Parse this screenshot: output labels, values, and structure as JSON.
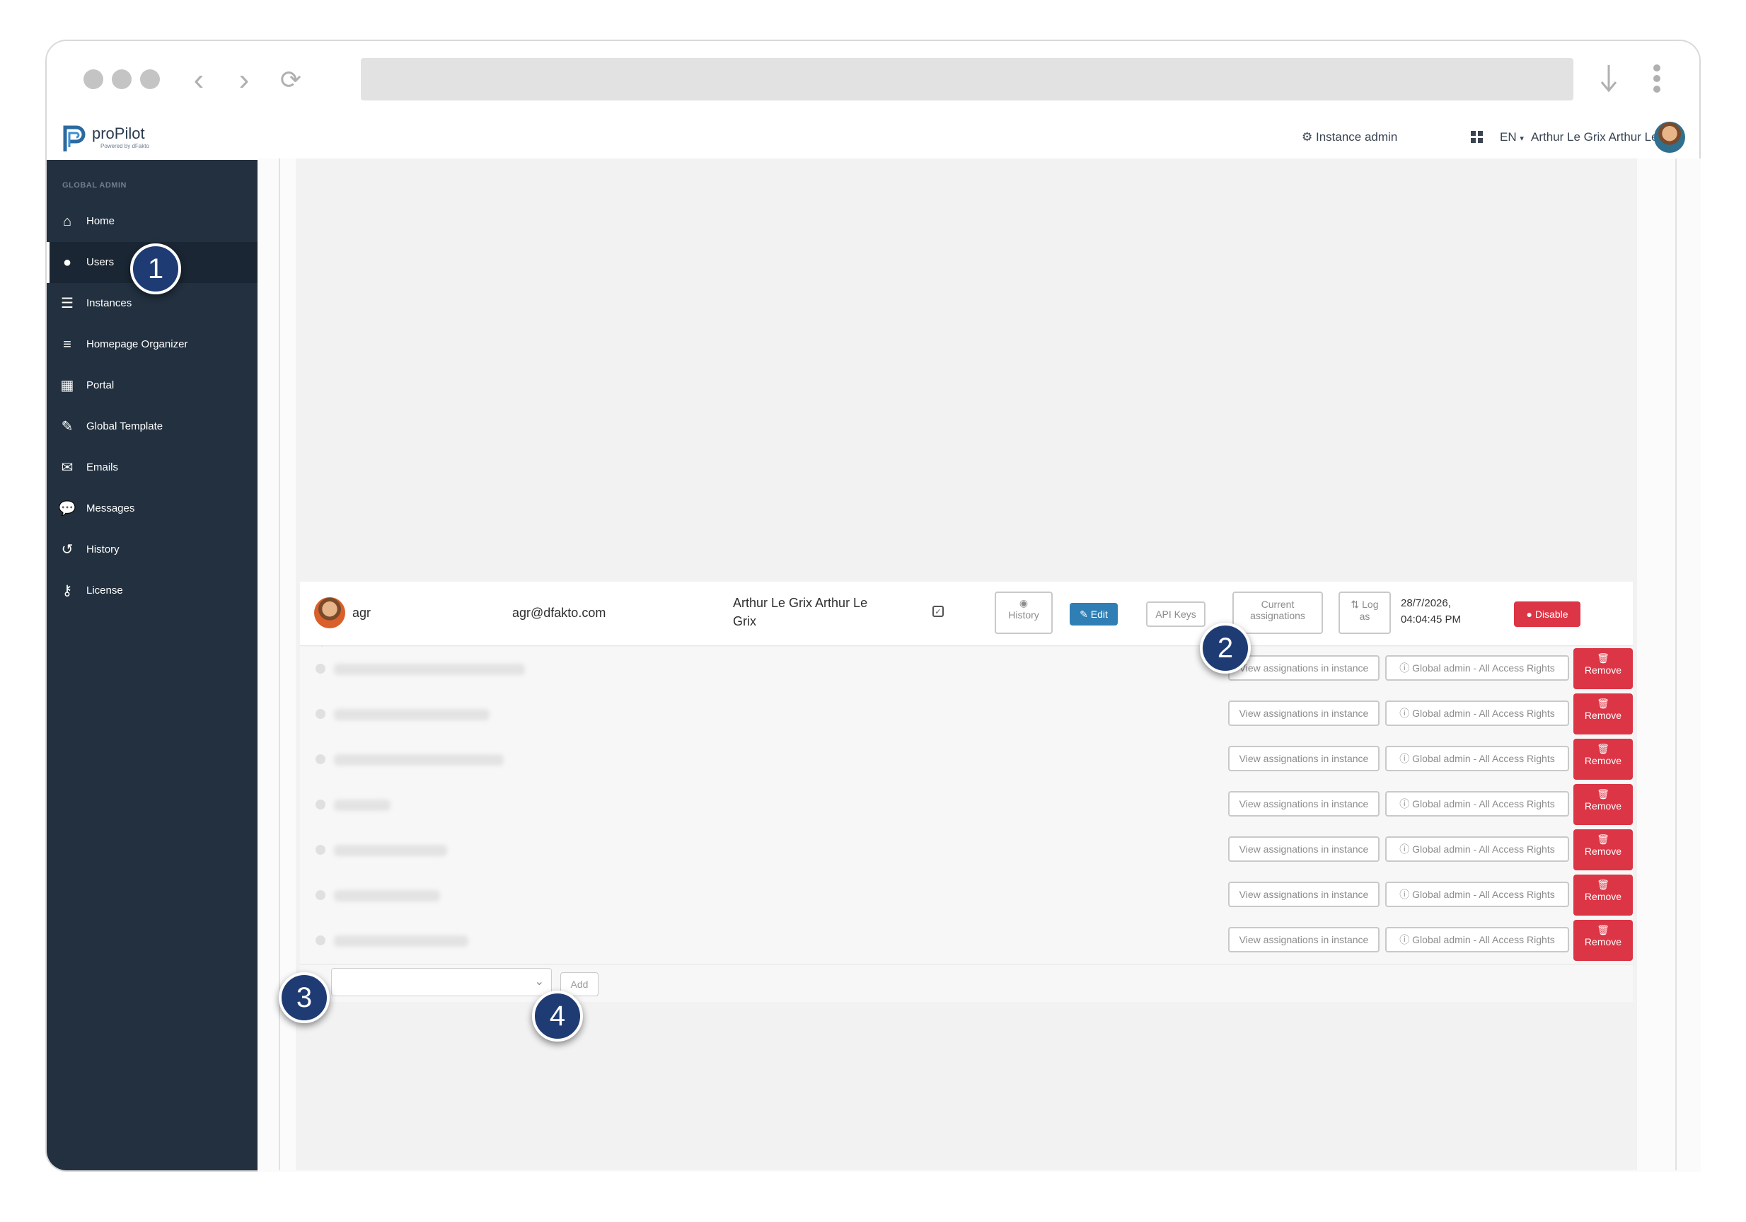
{
  "header": {
    "brand": "proPilot",
    "brand_sub": "Powered by dFakto",
    "instance_admin": "Instance admin",
    "language": "EN",
    "user_name": "Arthur Le Grix Arthur Le Grix"
  },
  "sidebar": {
    "section_title": "GLOBAL ADMIN",
    "items": [
      {
        "label": "Home",
        "icon": "home-icon"
      },
      {
        "label": "Users",
        "icon": "user-icon"
      },
      {
        "label": "Instances",
        "icon": "list-icon"
      },
      {
        "label": "Homepage Organizer",
        "icon": "menu-icon"
      },
      {
        "label": "Portal",
        "icon": "grid-icon"
      },
      {
        "label": "Global Template",
        "icon": "brush-icon"
      },
      {
        "label": "Emails",
        "icon": "envelope-icon"
      },
      {
        "label": "Messages",
        "icon": "chat-icon"
      },
      {
        "label": "History",
        "icon": "history-icon"
      },
      {
        "label": "License",
        "icon": "key-icon"
      }
    ]
  },
  "user_row": {
    "username": "agr",
    "email": "agr@dfakto.com",
    "full_name_line1": "Arthur Le Grix Arthur Le",
    "full_name_line2": "Grix",
    "history_label": "History",
    "edit_label": "Edit",
    "api_keys_label": "API Keys",
    "current_assign_line1": "Current",
    "current_assign_line2": "assignations",
    "log_as_line1": "Log",
    "log_as_line2": "as",
    "date_line1": "28/7/2026,",
    "date_line2": "04:04:45 PM",
    "disable_label": "Disable"
  },
  "assignments": {
    "view_label": "View assignations in instance",
    "global_label": "Global admin - All Access Rights",
    "remove_label": "Remove",
    "rows": 7
  },
  "add_row": {
    "add_label": "Add"
  },
  "callouts": [
    "1",
    "2",
    "3",
    "4"
  ],
  "colors": {
    "sidebar_bg": "#22303f",
    "danger": "#dc3545",
    "primary": "#2f7fb5",
    "callout": "#1f3b74"
  }
}
